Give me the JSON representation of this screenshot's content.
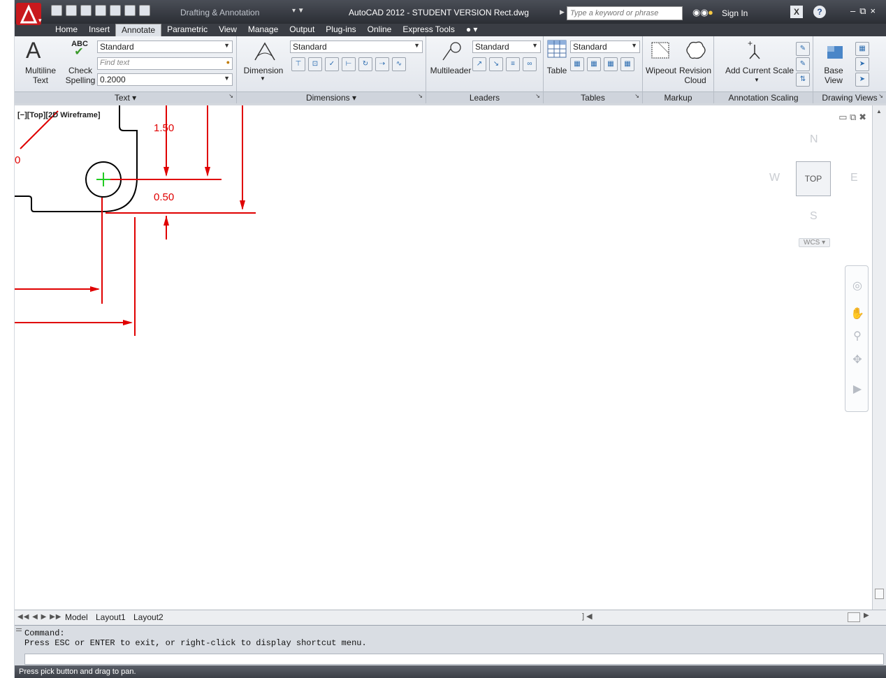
{
  "title_bar": {
    "workspace": "Drafting & Annotation",
    "title": "AutoCAD 2012 - STUDENT VERSION    Rect.dwg",
    "search_placeholder": "Type a keyword or phrase",
    "sign_in": "Sign In"
  },
  "tabs": [
    "Home",
    "Insert",
    "Annotate",
    "Parametric",
    "View",
    "Manage",
    "Output",
    "Plug-ins",
    "Online",
    "Express Tools"
  ],
  "ribbon": {
    "text_panel": {
      "title": "Text",
      "multiline_text": "Multiline\nText",
      "check_spelling_top": "ABC",
      "check_spelling": "Check\nSpelling",
      "style_combo": "Standard",
      "find_text_placeholder": "Find text",
      "height_combo": "0.2000"
    },
    "dimensions_panel": {
      "title": "Dimensions",
      "dimension_label": "Dimension",
      "style_combo": "Standard"
    },
    "leaders_panel": {
      "title": "Leaders",
      "multileader_label": "Multileader",
      "style_combo": "Standard"
    },
    "tables_panel": {
      "title": "Tables",
      "table_label": "Table",
      "style_combo": "Standard"
    },
    "markup_panel": {
      "title": "Markup",
      "wipeout_label": "Wipeout",
      "revision_cloud_label": "Revision\nCloud"
    },
    "annotation_scaling_panel": {
      "title": "Annotation Scaling",
      "add_current_scale_label": "Add Current Scale"
    },
    "drawing_views_panel": {
      "title": "Drawing Views",
      "base_view_label": "Base\nView"
    }
  },
  "viewport": {
    "label": "[−][Top][2D Wireframe]",
    "dim_values": [
      "1.50",
      "0.50",
      "0"
    ],
    "viewcube": {
      "north": "N",
      "south": "S",
      "east": "E",
      "west": "W",
      "face": "TOP",
      "wcs": "WCS"
    }
  },
  "layout_tabs": [
    "Model",
    "Layout1",
    "Layout2"
  ],
  "command_line": {
    "line1": "Command:",
    "line2": "Press ESC or ENTER to exit, or right-click to display shortcut menu."
  },
  "status_bar": {
    "prompt": "Press pick button and drag to pan."
  },
  "colors": {
    "dimension_red": "#e00000",
    "geometry_black": "#000000",
    "center_mark_green": "#22cc22",
    "title_bar_dark": "#2b2e34"
  }
}
